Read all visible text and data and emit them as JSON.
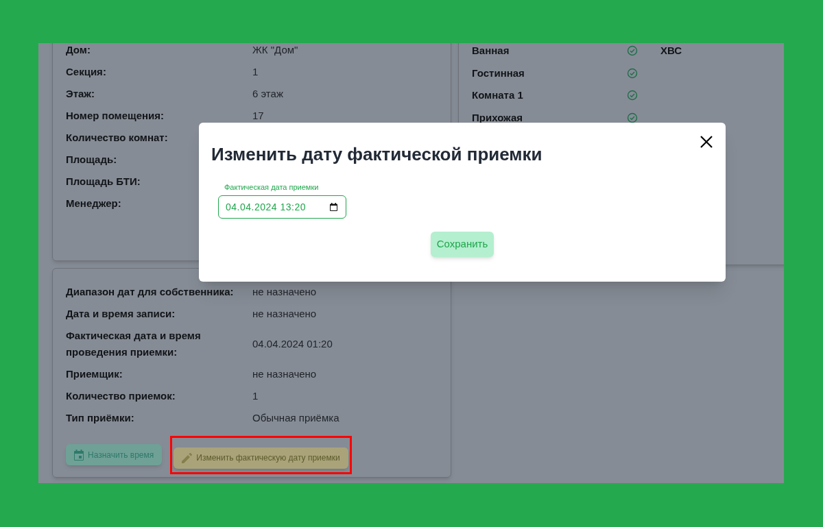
{
  "object_card": {
    "rows": [
      {
        "label": "Дом:",
        "value": "ЖК \"Дом\""
      },
      {
        "label": "Секция:",
        "value": "1"
      },
      {
        "label": "Этаж:",
        "value": "6 этаж"
      },
      {
        "label": "Номер помещения:",
        "value": "17"
      },
      {
        "label": "Количество комнат:"
      },
      {
        "label": "Площадь:"
      },
      {
        "label": "Площадь БТИ:"
      },
      {
        "label": "Менеджер:"
      }
    ]
  },
  "rooms_card": {
    "rows": [
      {
        "name": "Ванная",
        "done": true,
        "column_3": "ХВС"
      },
      {
        "name": "Гостинная",
        "done": true
      },
      {
        "name": "Комната 1",
        "done": true
      },
      {
        "name": "Прихожая",
        "done": true
      }
    ]
  },
  "inspection_card": {
    "rows": [
      {
        "label": "Диапазон дат для собственника:",
        "value": "не назначено"
      },
      {
        "label": "Дата и время записи:",
        "value": "не назначено"
      },
      {
        "label": "Фактическая дата и время проведения приемки:",
        "value": "04.04.2024 01:20"
      },
      {
        "label": "Приемщик:",
        "value": "не назначено"
      },
      {
        "label": "Количество приемок:",
        "value": "1"
      },
      {
        "label": "Тип приёмки:",
        "value": "Обычная приёмка"
      }
    ],
    "buttons": [
      {
        "kind": "schedule",
        "label": "Назначить время",
        "highlighted": false
      },
      {
        "kind": "edit",
        "label": "Изменить фактическую дату приемки",
        "highlighted": true
      }
    ]
  },
  "dialog": {
    "title": "Изменить дату фактической приемки",
    "field": {
      "label": "Фактическая дата приемки",
      "value": "04.04.2024 13:20"
    },
    "save_button": "Сохранить"
  }
}
